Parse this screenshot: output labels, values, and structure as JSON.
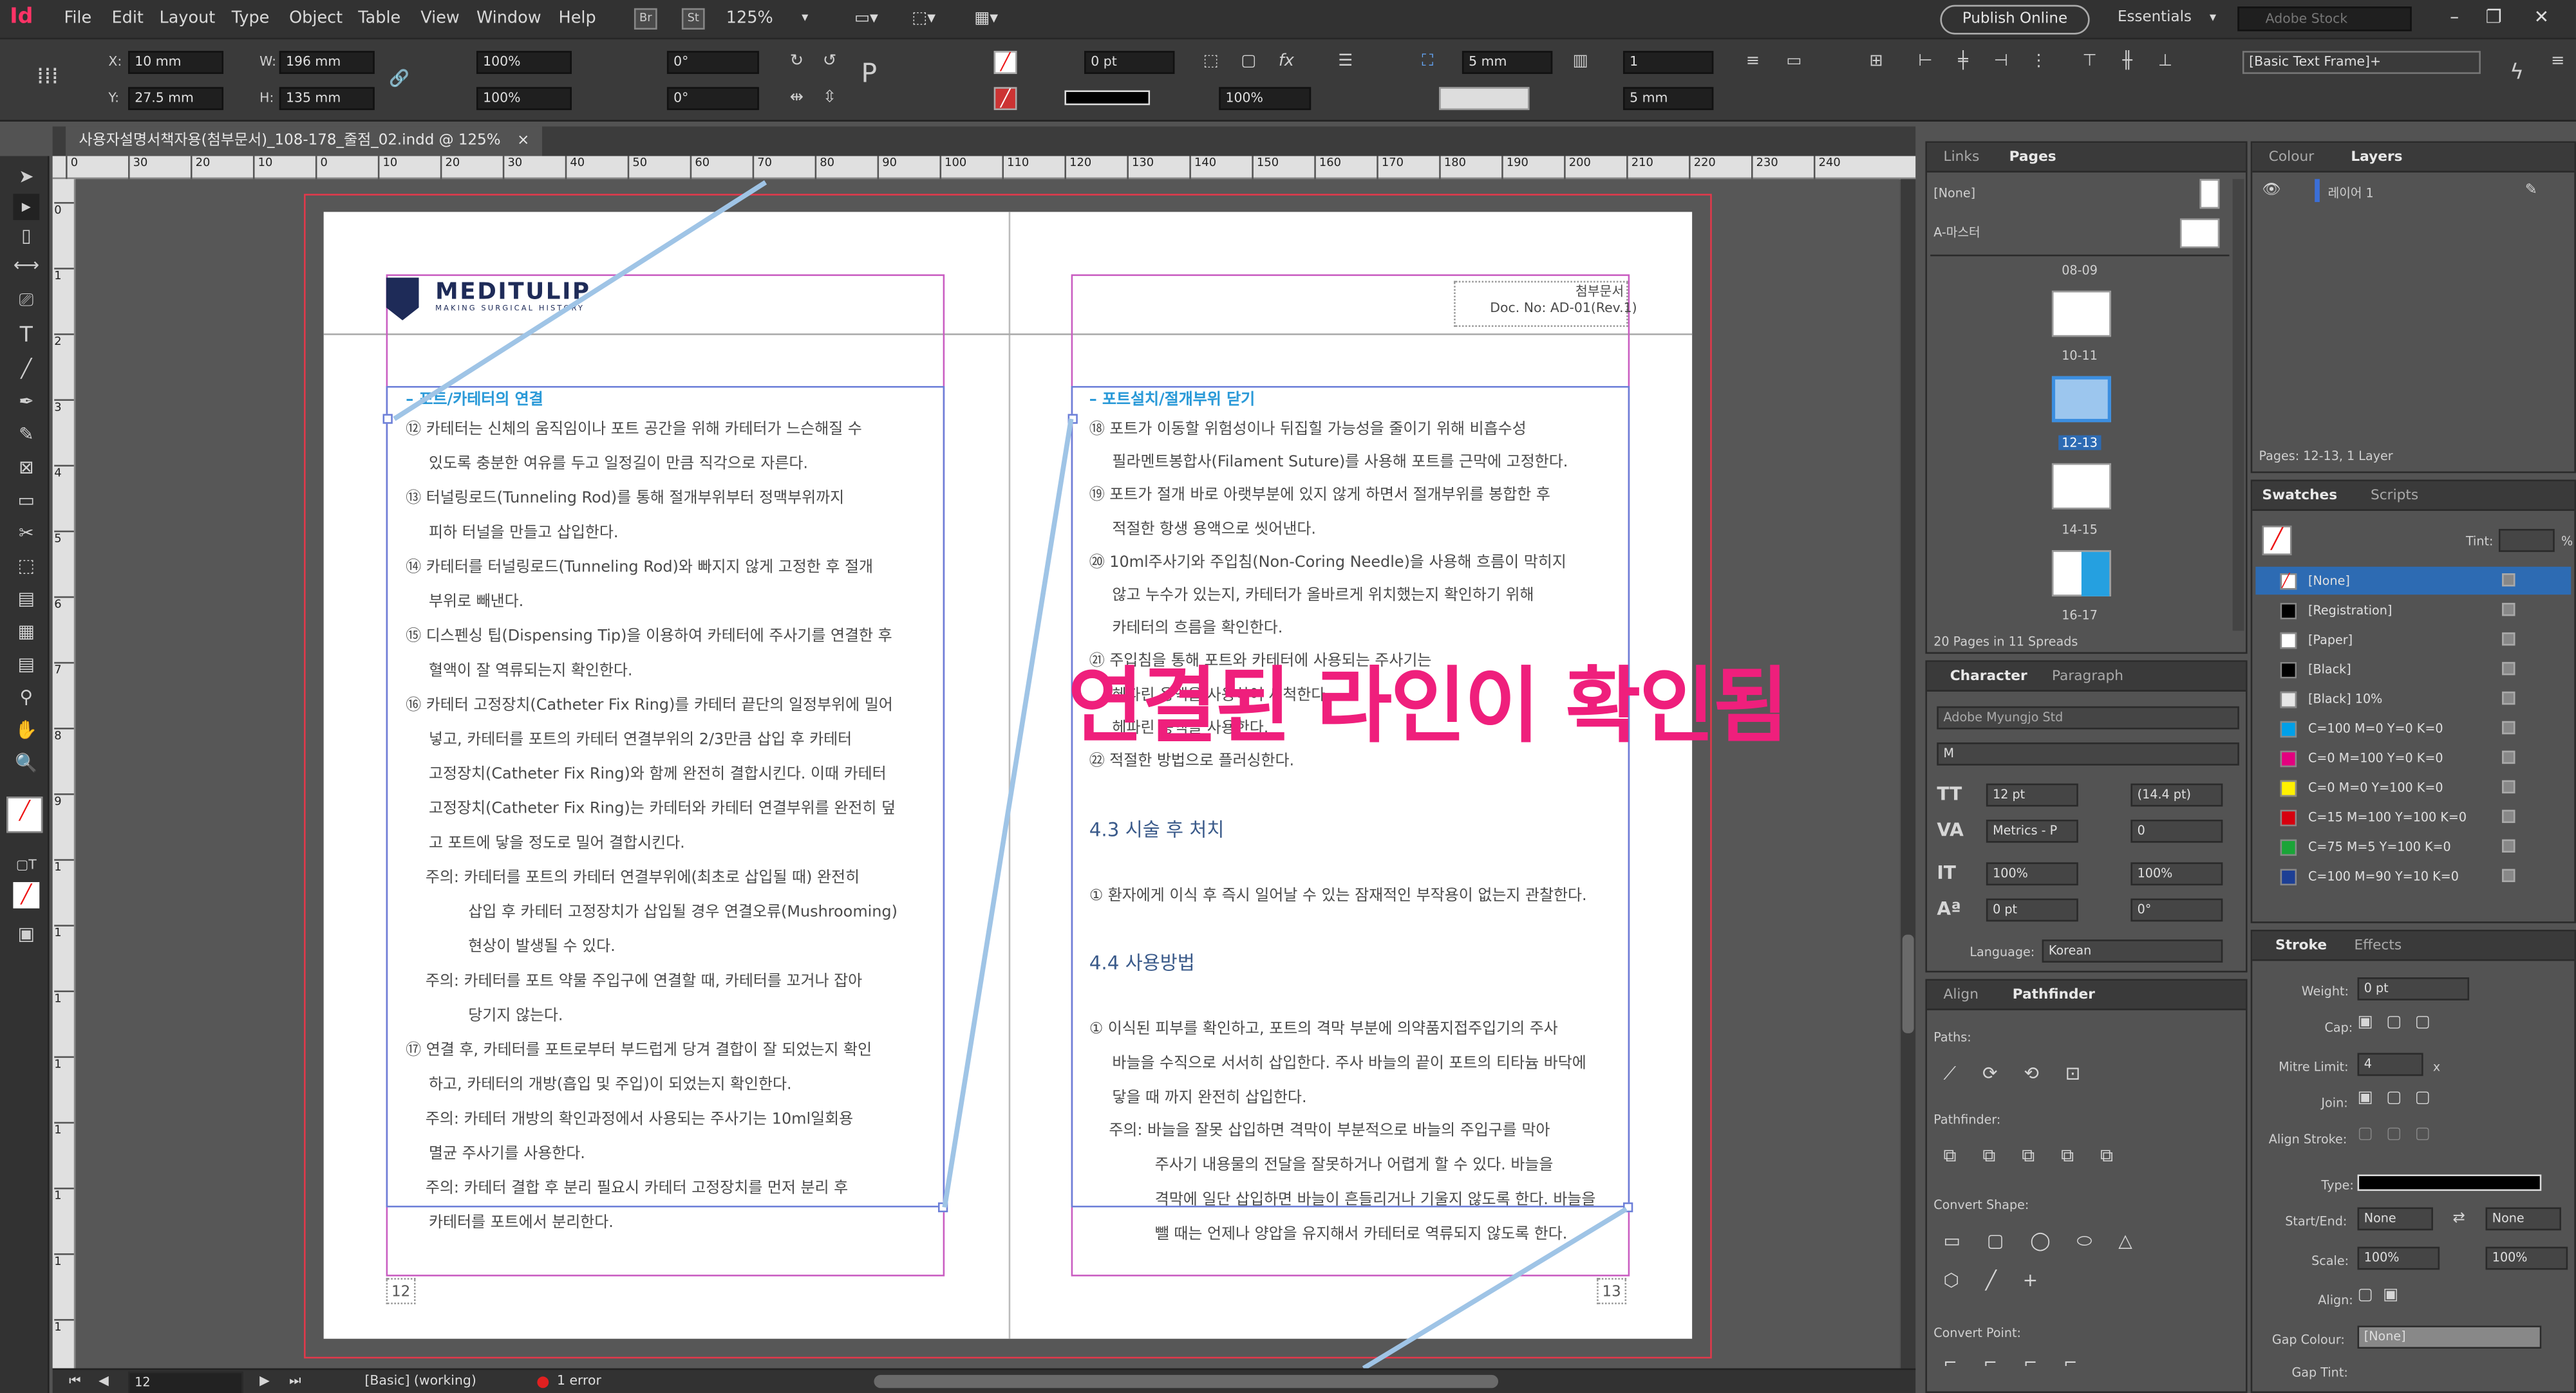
{
  "app": {
    "logo": "Id",
    "menu": [
      "File",
      "Edit",
      "Layout",
      "Type",
      "Object",
      "Table",
      "View",
      "Window",
      "Help"
    ],
    "bridge": "Br",
    "stock": "St",
    "zoom": "125%",
    "publish": "Publish Online",
    "workspace": "Essentials",
    "search_placeholder": "Adobe Stock"
  },
  "control": {
    "x": "10 mm",
    "y": "27.5 mm",
    "w": "196 mm",
    "h": "135 mm",
    "scale_x": "100%",
    "scale_y": "100%",
    "rotate": "0°",
    "shear": "0°",
    "stroke_weight": "0 pt",
    "opacity": "100%",
    "gutter": "5 mm",
    "columns": "1",
    "inset": "5 mm",
    "style": "[Basic Text Frame]+",
    "labels": {
      "x": "X:",
      "y": "Y:",
      "w": "W:",
      "h": "H:"
    }
  },
  "doc_tab": {
    "title": "사용자설명서책자용(첨부문서)_108-178_줄점_02.indd @ 125%",
    "close": "×"
  },
  "ruler": {
    "h_ticks": [
      "0",
      "30",
      "20",
      "10",
      "0",
      "10",
      "20",
      "30",
      "40",
      "50",
      "60",
      "70",
      "80",
      "90",
      "100",
      "110",
      "120",
      "130",
      "140",
      "150",
      "160",
      "170",
      "180",
      "190",
      "200",
      "210",
      "220",
      "230",
      "240"
    ],
    "v_ticks": [
      "0",
      "1",
      "2",
      "3",
      "4",
      "5",
      "6",
      "7",
      "8",
      "9",
      "1",
      "1",
      "1",
      "1",
      "1",
      "1",
      "1",
      "1"
    ]
  },
  "page_left": {
    "logo": "MEDITULIP",
    "tagline": "MAKING SURGICAL HISTORY",
    "page_num": "12",
    "heading": "– 포트/카테터의 연결",
    "lines": [
      "⑫ 카테터는 신체의 움직임이나 포트 공간을 위해 카테터가 느슨해질 수",
      "있도록 충분한 여유를 두고 일정길이 만큼 직각으로 자른다.",
      "⑬ 터널링로드(Tunneling Rod)를 통해 절개부위부터 정맥부위까지",
      "피하 터널을 만들고 삽입한다.",
      "⑭ 카테터를 터널링로드(Tunneling Rod)와 빠지지 않게 고정한 후 절개",
      "부위로 빼낸다.",
      "⑮ 디스펜싱 팁(Dispensing Tip)을 이용하여 카테터에 주사기를 연결한 후",
      "혈액이 잘 역류되는지 확인한다.",
      "⑯ 카테터 고정장치(Catheter Fix Ring)를 카테터 끝단의 일정부위에 밀어",
      "넣고, 카테터를 포트의 카테터 연결부위의 2/3만큼 삽입 후 카테터",
      "고정장치(Catheter Fix Ring)와 함께 완전히 결합시킨다. 이때 카테터",
      "고정장치(Catheter Fix Ring)는 카테터와 카테터 연결부위를 완전히 덮",
      "고 포트에 닿을 정도로 밀어 결합시킨다.",
      "주의: 카테터를 포트의 카테터 연결부위에(최초로 삽입될 때) 완전히",
      "삽입 후 카테터 고정장치가 삽입될 경우 연결오류(Mushrooming)",
      "현상이 발생될 수 있다.",
      "주의: 카테터를 포트 약물 주입구에 연결할 때, 카테터를 꼬거나 잡아",
      "당기지 않는다.",
      "⑰ 연결 후, 카테터를 포트로부터 부드럽게 당겨 결합이 잘 되었는지 확인",
      "하고, 카테터의 개방(흡입 및 주입)이 되었는지 확인한다.",
      "주의: 카테터 개방의 확인과정에서 사용되는 주사기는 10ml일회용",
      "멸균 주사기를 사용한다.",
      "주의: 카테터 결합 후 분리 필요시 카테터 고정장치를 먼저 분리 후",
      "카테터를 포트에서 분리한다."
    ]
  },
  "page_right": {
    "header_line1": "첨부문서",
    "header_line2": "Doc. No: AD-01(Rev.1)",
    "page_num": "13",
    "heading": "– 포트설치/절개부위 닫기",
    "lines": [
      "⑱ 포트가 이동할 위험성이나 뒤집힐 가능성을 줄이기 위해 비흡수성",
      "필라멘트봉합사(Filament Suture)를 사용해 포트를 근막에 고정한다.",
      "⑲ 포트가 절개 바로 아랫부분에 있지 않게 하면서 절개부위를 봉합한 후",
      "적절한 항생 용액으로 씻어낸다.",
      "⑳ 10ml주사기와 주입침(Non-Coring Needle)을 사용해 흐름이 막히지",
      "않고 누수가 있는지, 카테터가 올바르게 위치했는지 확인하기 위해",
      "카테터의 흐름을 확인한다.",
      "㉑ 주입침을 통해 포트와 카테터에 사용되는 주사기는",
      "헤파린 용액을 사용하여 세척한다.",
      "헤파린 용액을 사용한다.",
      "㉒ 적절한 방법으로 플러싱한다."
    ],
    "sec1": "4.3 시술 후 처치",
    "sec1_text": "① 환자에게 이식 후 즉시 일어날 수 있는 잠재적인 부작용이 없는지 관찰한다.",
    "sec2": "4.4 사용방법",
    "sec2_lines": [
      "① 이식된 피부를 확인하고, 포트의 격막 부분에 의약품지접주입기의 주사",
      "바늘을 수직으로 서서히 삽입한다. 주사 바늘의 끝이 포트의 티타늄 바닥에",
      "닿을 때 까지 완전히 삽입한다.",
      "주의: 바늘을 잘못 삽입하면 격막이 부분적으로 바늘의 주입구를 막아",
      "주사기 내용물의 전달을 잘못하거나 어렵게 할 수 있다. 바늘을",
      "격막에 일단 삽입하면 바늘이 흔들리거나 기울지 않도록 한다. 바늘을",
      "뺄 때는 언제나 양압을 유지해서 카테터로 역류되지 않도록 한다."
    ]
  },
  "annotation": "연결된 라인이 확인됨",
  "status": {
    "page": "12",
    "style": "[Basic] (working)",
    "errors": "1 error"
  },
  "pages_panel": {
    "tabs": [
      "Links",
      "Pages"
    ],
    "none": "[None]",
    "master": "A-마스터",
    "spreads": [
      "08-09",
      "10-11",
      "12-13",
      "14-15",
      "16-17"
    ],
    "footer": "20 Pages in 11 Spreads"
  },
  "layers_panel": {
    "tabs": [
      "Colour",
      "Layers"
    ],
    "layer": "레이어 1",
    "footer": "Pages: 12-13, 1 Layer"
  },
  "swatches_panel": {
    "tabs": [
      "Swatches",
      "Scripts"
    ],
    "tint_label": "Tint:",
    "tint_unit": "%",
    "items": [
      {
        "name": "[None]",
        "color": "#ffffff"
      },
      {
        "name": "[Registration]",
        "color": "#000000"
      },
      {
        "name": "[Paper]",
        "color": "#ffffff"
      },
      {
        "name": "[Black]",
        "color": "#000000"
      },
      {
        "name": "[Black] 10%",
        "color": "#e6e6e6"
      },
      {
        "name": "C=100 M=0 Y=0 K=0",
        "color": "#00a0e9"
      },
      {
        "name": "C=0 M=100 Y=0 K=0",
        "color": "#e4007f"
      },
      {
        "name": "C=0 M=0 Y=100 K=0",
        "color": "#fff100"
      },
      {
        "name": "C=15 M=100 Y=100 K=0",
        "color": "#d7000f"
      },
      {
        "name": "C=75 M=5 Y=100 K=0",
        "color": "#1aa538"
      },
      {
        "name": "C=100 M=90 Y=10 K=0",
        "color": "#1d3f95"
      }
    ]
  },
  "character_panel": {
    "tabs": [
      "Character",
      "Paragraph"
    ],
    "font": "Adobe Myungjo Std",
    "style": "M",
    "size": "12 pt",
    "leading": "(14.4 pt)",
    "kerning": "Metrics - P",
    "tracking": "0",
    "vscale": "100%",
    "hscale": "100%",
    "baseline": "0 pt",
    "skew": "0°",
    "language_label": "Language:",
    "language": "Korean"
  },
  "pathfinder_panel": {
    "tabs": [
      "Align",
      "Pathfinder"
    ],
    "paths": "Paths:",
    "pathfinder": "Pathfinder:",
    "convert_shape": "Convert Shape:",
    "convert_point": "Convert Point:"
  },
  "stroke_panel": {
    "tabs": [
      "Stroke",
      "Effects"
    ],
    "weight_label": "Weight:",
    "weight": "0 pt",
    "cap": "Cap:",
    "miter_label": "Mitre Limit:",
    "miter": "4",
    "miter_unit": "x",
    "join": "Join:",
    "align_stroke": "Align Stroke:",
    "type": "Type:",
    "start_end": "Start/End:",
    "start": "None",
    "end": "None",
    "scale": "Scale:",
    "scale1": "100%",
    "scale2": "100%",
    "align": "Align:",
    "gap_colour": "Gap Colour:",
    "gap_value": "[None]",
    "gap_tint": "Gap Tint:"
  }
}
